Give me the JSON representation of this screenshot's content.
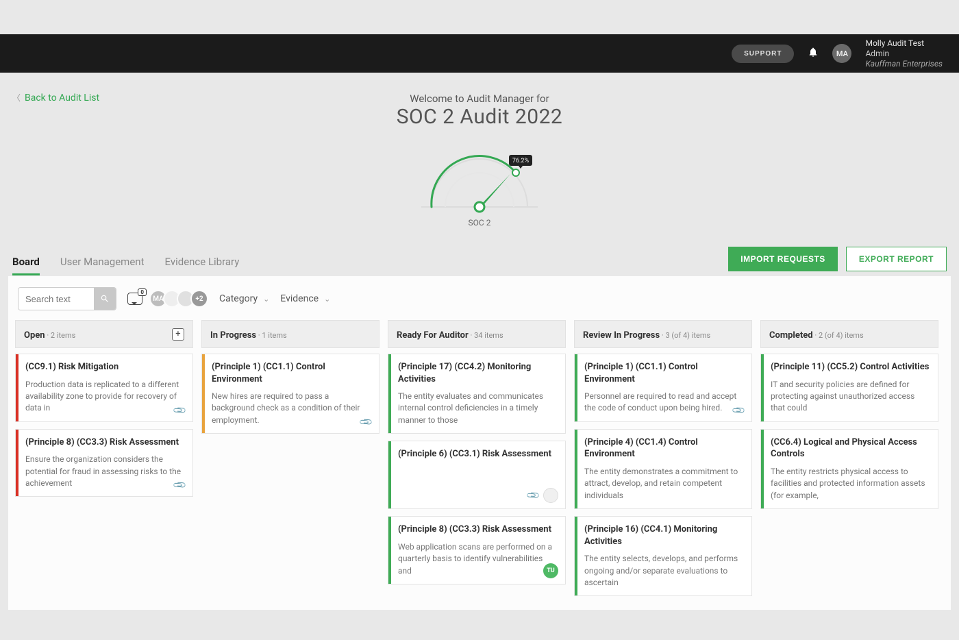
{
  "topbar": {
    "support": "SUPPORT",
    "avatar_initials": "MA",
    "user_name": "Molly Audit Test",
    "user_role": "Admin",
    "user_org": "Kauffman Enterprises"
  },
  "header": {
    "back_link": "Back to Audit List",
    "welcome_prefix": "Welcome to Audit Manager for",
    "audit_title": "SOC 2 Audit 2022",
    "gauge_percent": "76.2%",
    "gauge_label": "SOC 2"
  },
  "tabs": {
    "board": "Board",
    "user_mgmt": "User Management",
    "evidence_lib": "Evidence Library"
  },
  "actions": {
    "import": "IMPORT REQUESTS",
    "export": "EXPORT REPORT"
  },
  "toolbar": {
    "search_placeholder": "Search text",
    "comment_count": "0",
    "avatar1": "MA",
    "avatar_more": "+2",
    "filter_category": "Category",
    "filter_evidence": "Evidence"
  },
  "columns": [
    {
      "title": "Open",
      "count_text": "· 2 items",
      "has_add": true,
      "cards": [
        {
          "stripe": "s-red",
          "title": "(CC9.1) Risk Mitigation",
          "desc": "Production data is replicated to a different availability zone to provide for recovery of data in",
          "clip": true
        },
        {
          "stripe": "s-red",
          "title": "(Principle 8) (CC3.3) Risk Assessment",
          "desc": "Ensure the organization considers the potential for fraud in assessing risks to the achievement",
          "clip": true
        }
      ]
    },
    {
      "title": "In Progress",
      "count_text": "· 1 items",
      "cards": [
        {
          "stripe": "s-orange",
          "title": "(Principle 1) (CC1.1) Control Environment",
          "desc": "New hires are required to pass a background check as a condition of their employment.",
          "clip": true
        }
      ]
    },
    {
      "title": "Ready For Auditor",
      "count_text": "· 34 items",
      "cards": [
        {
          "stripe": "s-green",
          "title": "(Principle 17) (CC4.2) Monitoring Activities",
          "desc": "The entity evaluates and communicates internal control deficiencies in a timely manner to those"
        },
        {
          "stripe": "s-green",
          "title": "(Principle 6) (CC3.1) Risk Assessment",
          "desc": "",
          "clip": true,
          "faint_avatar": true,
          "tall": true
        },
        {
          "stripe": "s-green",
          "title": "(Principle 8) (CC3.3) Risk Assessment",
          "desc": "Web application scans are performed on a quarterly basis to identify vulnerabilities and",
          "avatar": "TU"
        }
      ]
    },
    {
      "title": "Review In Progress",
      "count_text": "· 3 (of 4) items",
      "cards": [
        {
          "stripe": "s-green",
          "title": "(Principle 1) (CC1.1) Control Environment",
          "desc": "Personnel are required to read and accept the code of conduct upon being hired.",
          "clip": true
        },
        {
          "stripe": "s-green",
          "title": "(Principle 4) (CC1.4) Control Environment",
          "desc": "The entity demonstrates a commitment to attract, develop, and retain competent individuals"
        },
        {
          "stripe": "s-green",
          "title": "(Principle 16) (CC4.1) Monitoring Activities",
          "desc": "The entity selects, develops, and performs ongoing and/or separate evaluations to ascertain"
        }
      ]
    },
    {
      "title": "Completed",
      "count_text": "· 2 (of 4) items",
      "cards": [
        {
          "stripe": "s-green",
          "title": "(Principle 11) (CC5.2) Control Activities",
          "desc": "IT and security policies are defined for protecting against unauthorized access that could"
        },
        {
          "stripe": "s-green",
          "title": "(CC6.4) Logical and Physical Access Controls",
          "desc": "The entity restricts physical access to facilities and protected information assets (for example,"
        }
      ]
    }
  ]
}
